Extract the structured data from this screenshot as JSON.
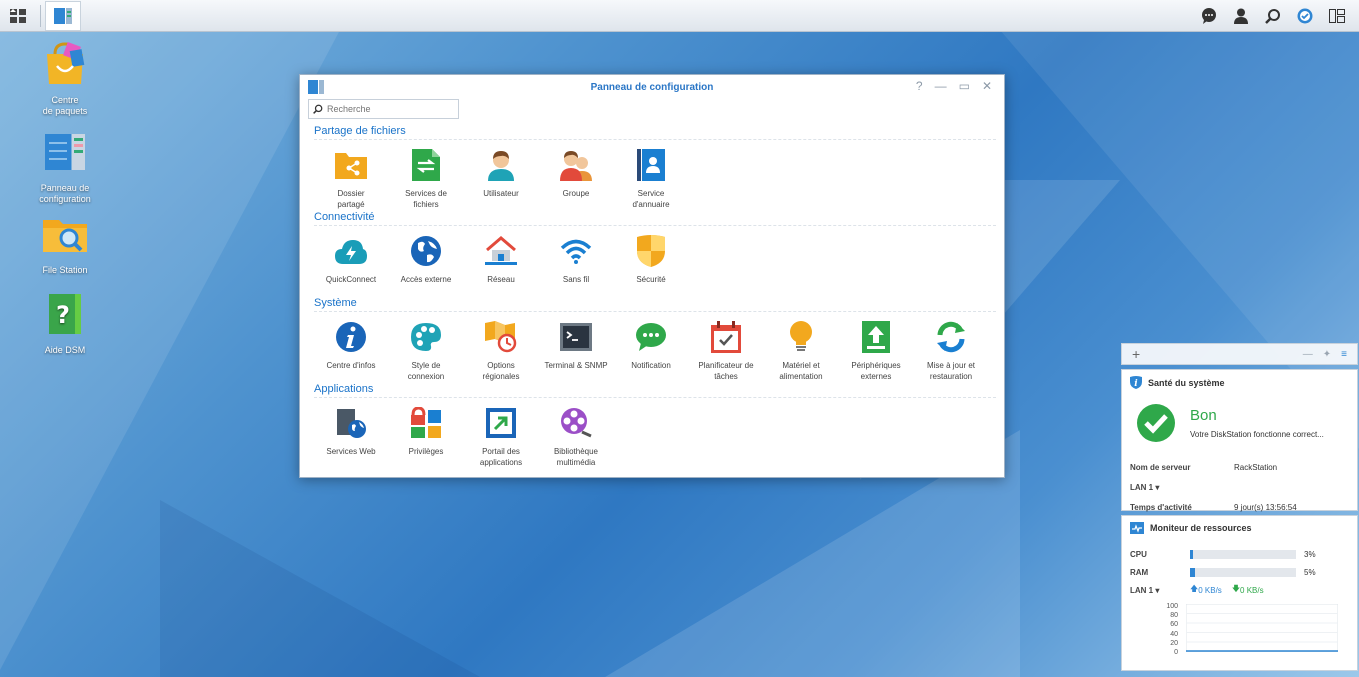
{
  "desktop": {
    "icons": [
      {
        "label_1": "Centre",
        "label_2": "de paquets"
      },
      {
        "label_1": "Panneau de",
        "label_2": "configuration"
      },
      {
        "label_1": "File Station",
        "label_2": ""
      },
      {
        "label_1": "Aide DSM",
        "label_2": ""
      }
    ]
  },
  "window": {
    "title": "Panneau de configuration",
    "controls": {
      "help": "?",
      "minimize": "—",
      "maximize": "▭",
      "close": "✕"
    },
    "search_placeholder": "Recherche",
    "sections": [
      {
        "title": "Partage de fichiers",
        "items": [
          {
            "l1": "Dossier",
            "l2": "partagé",
            "icon": "shared-folder-icon"
          },
          {
            "l1": "Services de",
            "l2": "fichiers",
            "icon": "file-services-icon"
          },
          {
            "l1": "Utilisateur",
            "l2": "",
            "icon": "user-icon"
          },
          {
            "l1": "Groupe",
            "l2": "",
            "icon": "group-icon"
          },
          {
            "l1": "Service",
            "l2": "d'annuaire",
            "icon": "directory-service-icon"
          }
        ]
      },
      {
        "title": "Connectivité",
        "items": [
          {
            "l1": "QuickConnect",
            "l2": "",
            "icon": "quickconnect-icon"
          },
          {
            "l1": "Accès externe",
            "l2": "",
            "icon": "external-access-icon"
          },
          {
            "l1": "Réseau",
            "l2": "",
            "icon": "network-icon"
          },
          {
            "l1": "Sans fil",
            "l2": "",
            "icon": "wireless-icon"
          },
          {
            "l1": "Sécurité",
            "l2": "",
            "icon": "security-icon"
          }
        ]
      },
      {
        "title": "Système",
        "items": [
          {
            "l1": "Centre d'infos",
            "l2": "",
            "icon": "info-center-icon"
          },
          {
            "l1": "Style de",
            "l2": "connexion",
            "icon": "login-style-icon"
          },
          {
            "l1": "Options",
            "l2": "régionales",
            "icon": "regional-options-icon"
          },
          {
            "l1": "Terminal & SNMP",
            "l2": "",
            "icon": "terminal-icon"
          },
          {
            "l1": "Notification",
            "l2": "",
            "icon": "notification-icon"
          },
          {
            "l1": "Planificateur de",
            "l2": "tâches",
            "icon": "task-scheduler-icon"
          },
          {
            "l1": "Matériel et",
            "l2": "alimentation",
            "icon": "hardware-power-icon"
          },
          {
            "l1": "Périphériques",
            "l2": "externes",
            "icon": "external-devices-icon"
          },
          {
            "l1": "Mise à jour et",
            "l2": "restauration",
            "icon": "update-restore-icon"
          }
        ]
      },
      {
        "title": "Applications",
        "items": [
          {
            "l1": "Services Web",
            "l2": "",
            "icon": "web-services-icon"
          },
          {
            "l1": "Privilèges",
            "l2": "",
            "icon": "privileges-icon"
          },
          {
            "l1": "Portail des",
            "l2": "applications",
            "icon": "application-portal-icon"
          },
          {
            "l1": "Bibliothèque",
            "l2": "multimédia",
            "icon": "media-library-icon"
          }
        ]
      }
    ]
  },
  "widgets": {
    "add": "+",
    "health": {
      "title": "Santé du système",
      "status": "Bon",
      "message": "Votre DiskStation fonctionne correct...",
      "server_label": "Nom de serveur",
      "server_value": "RackStation",
      "lan_label": "LAN 1 ▾",
      "uptime_label": "Temps d'activité",
      "uptime_value": "9 jour(s) 13:56:54"
    },
    "resources": {
      "title": "Moniteur de ressources",
      "cpu_label": "CPU",
      "cpu_value": "3%",
      "cpu_fraction": 0.03,
      "ram_label": "RAM",
      "ram_value": "5%",
      "ram_fraction": 0.05,
      "lan_label": "LAN 1 ▾",
      "upload": "0 KB/s",
      "download": "0 KB/s",
      "y_ticks": [
        "100",
        "80",
        "60",
        "40",
        "20",
        "0"
      ]
    }
  }
}
